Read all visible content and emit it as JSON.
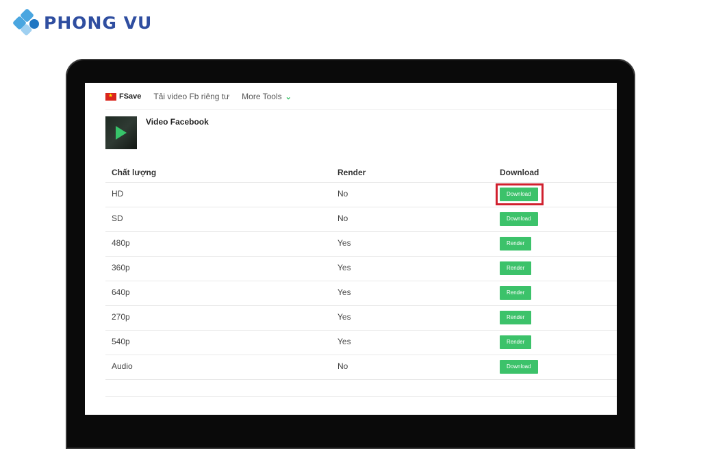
{
  "brand": {
    "logo_text": "PHONG VU"
  },
  "nav": {
    "site_name": "FSave",
    "link_private": "Tải video Fb riêng tư",
    "more_tools": "More Tools"
  },
  "video": {
    "title": "Video Facebook"
  },
  "table": {
    "headers": [
      "Chất lượng",
      "Render",
      "Download"
    ],
    "rows": [
      {
        "quality": "HD",
        "render": "No",
        "action": "Download",
        "highlighted": true
      },
      {
        "quality": "SD",
        "render": "No",
        "action": "Download"
      },
      {
        "quality": "480p",
        "render": "Yes",
        "action": "Render"
      },
      {
        "quality": "360p",
        "render": "Yes",
        "action": "Render"
      },
      {
        "quality": "640p",
        "render": "Yes",
        "action": "Render"
      },
      {
        "quality": "270p",
        "render": "Yes",
        "action": "Render"
      },
      {
        "quality": "540p",
        "render": "Yes",
        "action": "Render"
      },
      {
        "quality": "Audio",
        "render": "No",
        "action": "Download"
      }
    ]
  },
  "colors": {
    "accent": "#3cc26a",
    "highlight": "#d0202e",
    "brand": "#2f4ea0"
  }
}
